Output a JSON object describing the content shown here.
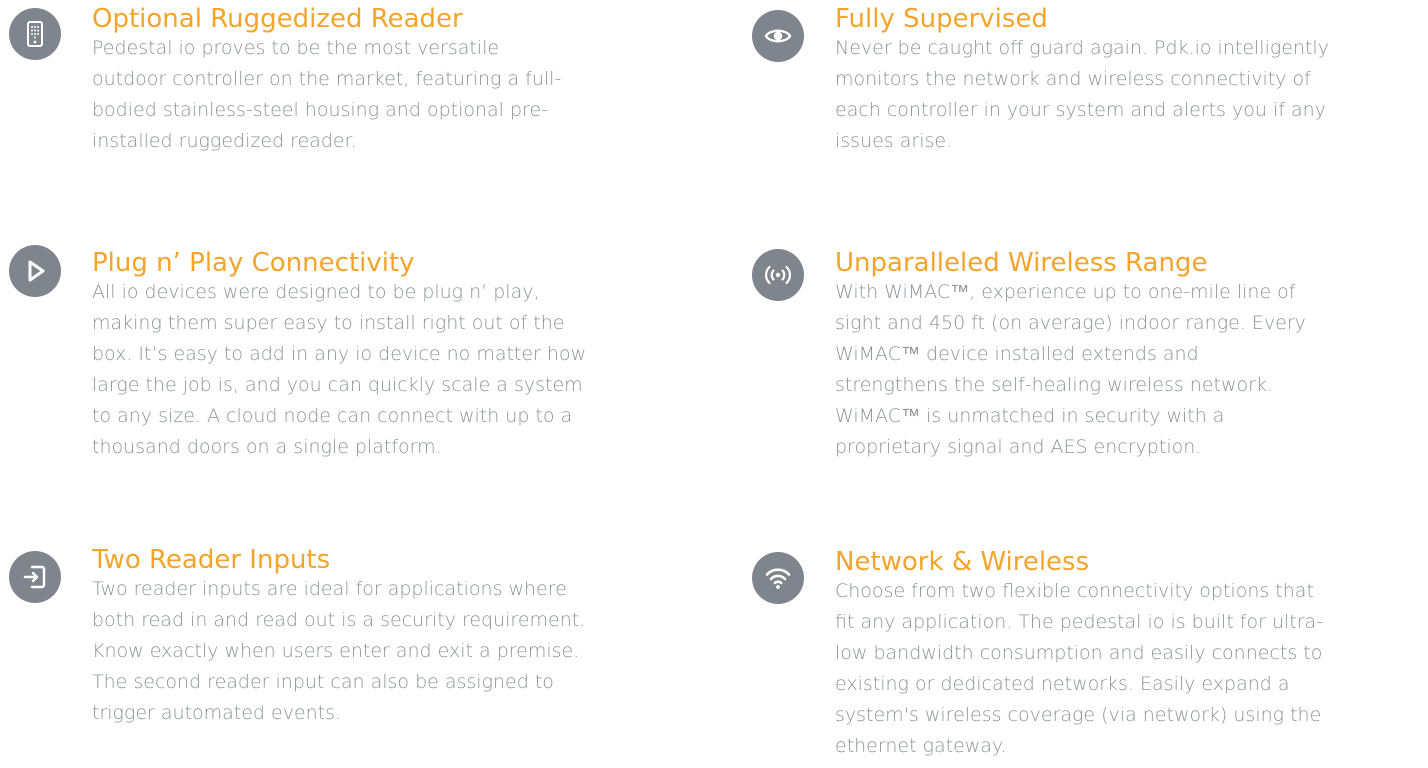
{
  "colors": {
    "accent": "#f3a42b",
    "icon_background": "#7f858c",
    "body_text": "#8e9398"
  },
  "features": [
    {
      "icon": "keypad-reader-icon",
      "title": "Optional Ruggedized Reader",
      "description": "Pedestal io proves to be the most versatile\noutdoor controller on the market, featuring a full-\nbodied stainless-steel housing and optional pre-\ninstalled ruggedized reader."
    },
    {
      "icon": "eye-icon",
      "title": "Fully Supervised",
      "description": "Never be caught off guard again. Pdk.io intelligently\nmonitors the network and wireless connectivity of\neach controller in your system and alerts you if any\nissues arise."
    },
    {
      "icon": "play-icon",
      "title": "Plug n’ Play Connectivity",
      "description": "All io devices were designed to be plug n’ play,\nmaking them super easy to install right out of the\nbox. It’s easy to add in any io device no matter how\nlarge the job is, and you can quickly scale a system\nto any size. A cloud node can connect with up to a\nthousand doors on a single platform."
    },
    {
      "icon": "wireless-signal-icon",
      "title": "Unparalleled Wireless Range",
      "description": "With WiMAC™, experience up to one-mile line of\nsight and 450 ft (on average) indoor range. Every\nWiMAC™ device installed extends and\nstrengthens the self-healing wireless network.\nWiMAC™ is unmatched in security with a\nproprietary signal and AES encryption."
    },
    {
      "icon": "enter-door-icon",
      "title": "Two Reader Inputs",
      "description": "Two reader inputs are ideal for applications where\nboth read in and read out is a security requirement.\nKnow exactly when users enter and exit a premise.\nThe second reader input can also be assigned to\ntrigger automated events."
    },
    {
      "icon": "wifi-icon",
      "title": "Network & Wireless",
      "description": "Choose from two flexible connectivity options that\nfit any application. The pedestal io is built for ultra-\nlow bandwidth consumption and easily connects to\nexisting or dedicated networks. Easily expand a\nsystem's wireless coverage (via network) using the\nethernet gateway."
    }
  ]
}
